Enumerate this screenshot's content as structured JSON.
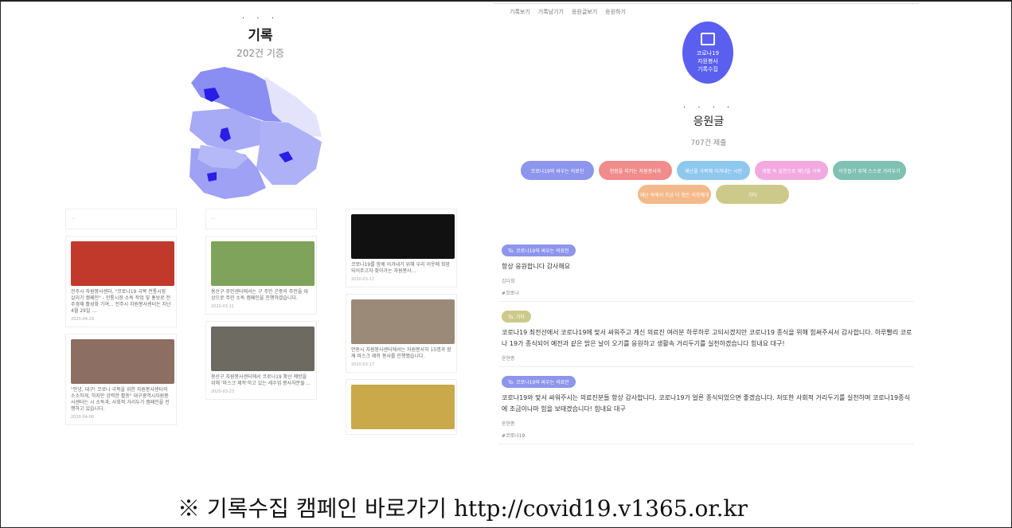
{
  "left": {
    "dots": "· · ·",
    "title": "기록",
    "count": "202건 기증",
    "cards": [
      {
        "text": "전주시 자원봉사센터, \"코로나19 극복 전통시장 살리기 캠페인\" - 전통시장 소독 작업 및 홍보로 전주경제 활성화 기여... 전주시 자원봉사센터는 지난 4월 29일 ...",
        "meta": "2020-04-29",
        "photo": "#c0392b"
      },
      {
        "text": "\"안녕, 대구! 코로나 극복을 위한 자원봉사센터의 소소하게, 하지만 강력한 활동\" 대구광역시자원봉사센터는 시 소독과, 사회적 거리두기 캠페인을 진행하고 있습니다.",
        "meta": "2020-04-08",
        "photo": "#8d6e63"
      },
      {
        "text": "용산구 주민센터에서는 구 주민 곤중의 주민을 대상으로 주민 소독 캠페인을 진행하였습니다.",
        "meta": "2020-03-11",
        "photo": "#7fa35a"
      },
      {
        "text": "용산구 자원봉사센터에서 코로나19 확산 예방을 위해 '마스크 제작'하고 있는 세수업 봉사자분들 ...",
        "meta": "2020-03-23",
        "photo": "#6d6a62"
      },
      {
        "text": "코로나19를 함께 이겨내기 위해 우리 이웃에 희망 되어주고자 찾아가는 자원봉사...",
        "meta": "2020-03-17",
        "photo": "#111111"
      },
      {
        "text": "안동시 자원봉사센터에서는 자원봉사자 15명과 함께 마스크 제작 봉사를 진행했습니다.",
        "meta": "2020-03-17",
        "photo": "#9c8a78"
      },
      {
        "text": "",
        "meta": "",
        "photo": "#c9a94a"
      }
    ]
  },
  "right": {
    "topnav": [
      "기록보기",
      "기록남기기",
      "응원글보기",
      "응원하기"
    ],
    "badge": {
      "line1": "코로나19",
      "line2": "자원봉사",
      "line3": "기록수집"
    },
    "dots": "· · · · ·",
    "title": "응원글",
    "count": "707건 제출",
    "categories": [
      {
        "label": "코로나19와 싸우는 의료진",
        "color": "#8d95ec"
      },
      {
        "label": "현장을 지키는 자원봉사자",
        "color": "#f08c8c"
      },
      {
        "label": "재난을 극복해 이겨내는 시민",
        "color": "#8fc8ef"
      },
      {
        "label": "생활 속 실천으로 재난을 극복",
        "color": "#f2a9e0"
      },
      {
        "label": "이웃돕기 위해 스스로 거리두기",
        "color": "#7fc1b3"
      },
      {
        "label": "재난 속에서 조금 더 힘든 이웃에게",
        "color": "#f4b98a"
      },
      {
        "label": "기타",
        "color": "#cdc98a"
      }
    ],
    "posts": [
      {
        "tag": "To. 코로나19와 싸우는 의료진",
        "tagColor": "#8d95ec",
        "body": "항상 응원합니다 감사해요",
        "author": "김다희",
        "hash": "#코로나"
      },
      {
        "tag": "To. 기타",
        "tagColor": "#cdc98a",
        "body": "코로나19 최전선에서 코로나19에 맞서 싸워주고 계신 의료진 여러분 하루하루 고되시겠지만 코로나19 종식을 위해 힘써주셔서 감사합니다. 하루빨리 코로나 19가 종식되어 예전과 같은 밝은 날이 오기를 응원하고 생활속 거리두기를 실천하겠습니다 힘내요 대구!",
        "author": "윤현종",
        "hash": ""
      },
      {
        "tag": "To. 코로나19와 싸우는 의료진",
        "tagColor": "#8d95ec",
        "body": "코로나19와 맞서 싸워주시는 의료진분들 항상 감사합니다. 코로나19가 얼른 종식되었으면 좋겠습니다. 저또한 사회적 거리두기를 실천하며 코로나19종식에 조금이나마 힘을 보태겠습니다! 힘내요 대구",
        "author": "윤현종",
        "hash": "#코로나19"
      }
    ]
  },
  "bottom_text": "※ 기록수집 캠페인 바로가기 http://covid19.v1365.or.kr"
}
